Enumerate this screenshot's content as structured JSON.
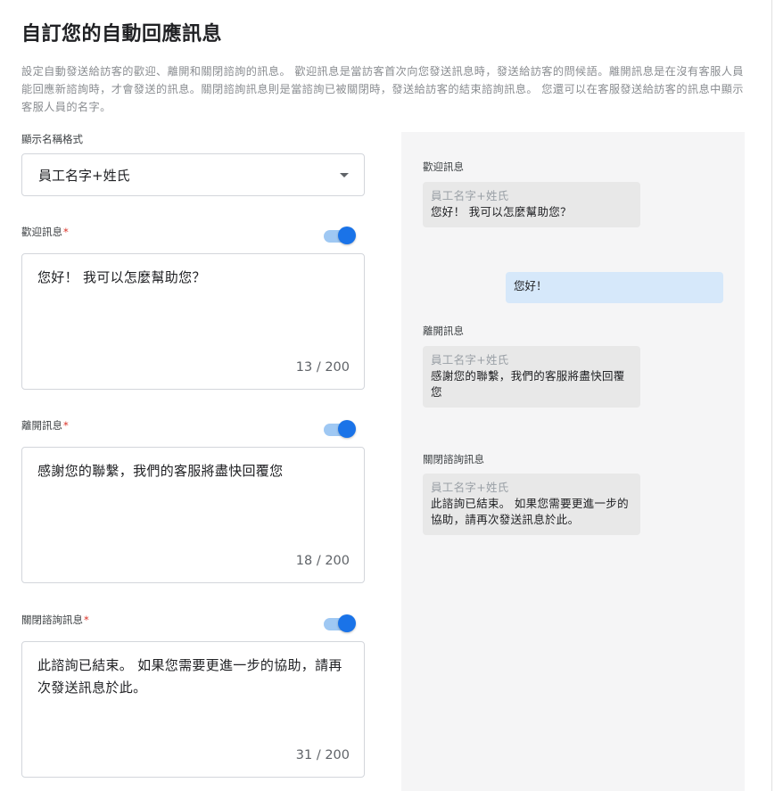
{
  "page": {
    "title": "自訂您的自動回應訊息",
    "description": "設定自動發送給訪客的歡迎、離開和關閉諮詢的訊息。 歡迎訊息是當訪客首次向您發送訊息時，發送給訪客的問候語。離開訊息是在沒有客服人員能回應新諮詢時，才會發送的訊息。關閉諮詢訊息則是當諮詢已被關閉時，發送給訪客的結束諮詢訊息。 您還可以在客服發送給訪客的訊息中顯示客服人員的名字。"
  },
  "display_name": {
    "label": "顯示名稱格式",
    "selected": "員工名字+姓氏"
  },
  "welcome": {
    "label": "歡迎訊息",
    "required_mark": "*",
    "enabled": true,
    "text": "您好！ 我可以怎麼幫助您？",
    "counter": "13 / 200"
  },
  "away": {
    "label": "離開訊息",
    "required_mark": "*",
    "enabled": true,
    "text": "感謝您的聯繫，我們的客服將盡快回覆您",
    "counter": "18 / 200"
  },
  "close": {
    "label": "關閉諮詢訊息",
    "required_mark": "*",
    "enabled": true,
    "text": "此諮詢已結束。 如果您需要更進一步的協助，請再次發送訊息於此。",
    "counter": "31 / 200"
  },
  "preview": {
    "welcome_label": "歡迎訊息",
    "welcome_sender": "員工名字+姓氏",
    "welcome_text": "您好！ 我可以怎麼幫助您？",
    "user_text": "您好！",
    "away_label": "離開訊息",
    "away_sender": "員工名字+姓氏",
    "away_text": "感謝您的聯繫，我們的客服將盡快回覆您",
    "close_label": "關閉諮詢訊息",
    "close_sender": "員工名字+姓氏",
    "close_text": "此諮詢已結束。 如果您需要更進一步的協助，請再次發送訊息於此。"
  },
  "colors": {
    "accent": "#1a73e8",
    "toggle_track": "#9fc8f3",
    "required": "#d93025",
    "preview_bg": "#f5f5f6",
    "user_bubble": "#d6e8fa"
  }
}
